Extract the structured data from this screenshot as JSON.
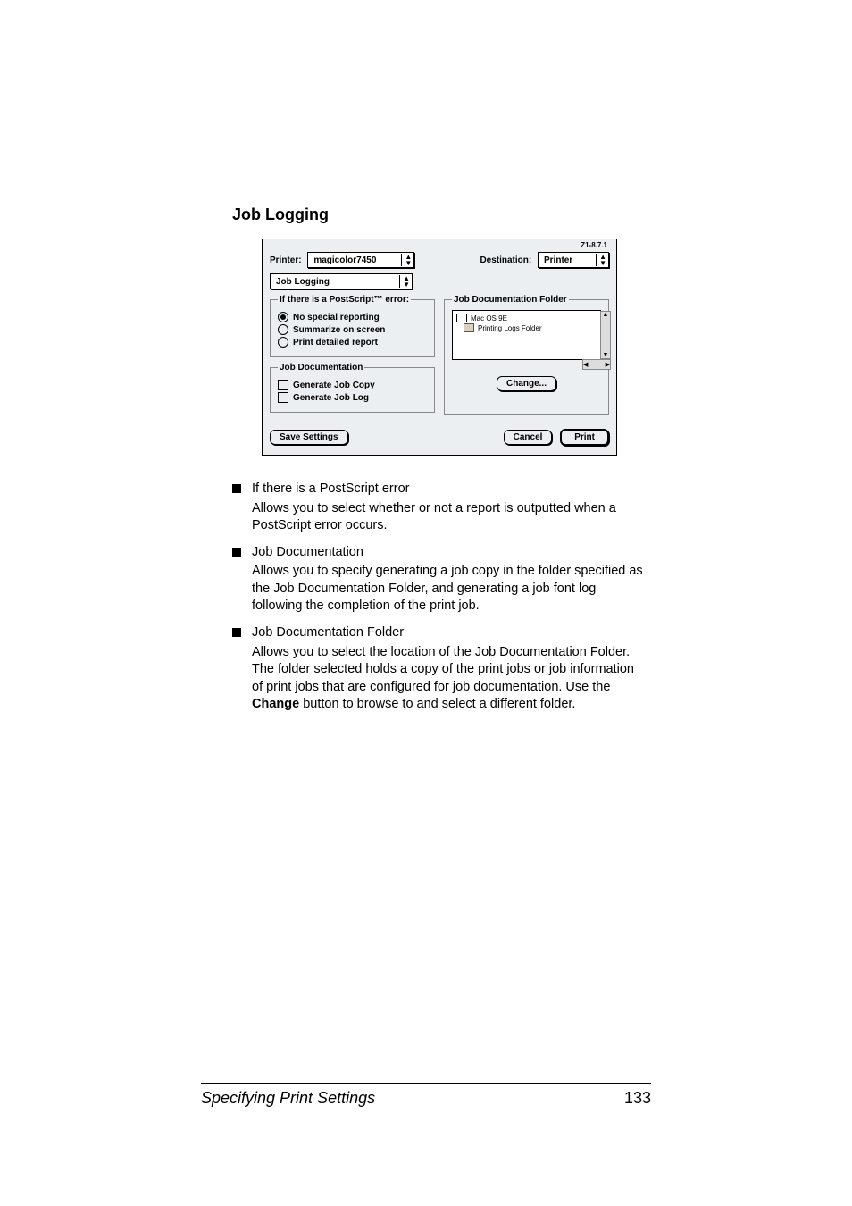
{
  "heading": "Job Logging",
  "dialog": {
    "version": "Z1-8.7.1",
    "printer_label": "Printer:",
    "printer_value": "magicolor7450",
    "destination_label": "Destination:",
    "destination_value": "Printer",
    "section_popup": "Job Logging",
    "ps_error": {
      "legend": "If there is a PostScript™ error:",
      "opt1": "No special reporting",
      "opt2": "Summarize on screen",
      "opt3": "Print detailed report"
    },
    "jobdoc": {
      "legend": "Job Documentation",
      "chk1": "Generate Job Copy",
      "chk2": "Generate Job Log"
    },
    "jobdoc_folder": {
      "legend": "Job Documentation Folder",
      "entry1": "Mac OS 9E",
      "entry2": "Printing Logs Folder",
      "change": "Change..."
    },
    "save_settings": "Save Settings",
    "cancel": "Cancel",
    "print": "Print"
  },
  "bullets": [
    {
      "title": "If there is a PostScript error",
      "body": "Allows you to select whether or not a report is outputted when a PostScript error occurs."
    },
    {
      "title": "Job Documentation",
      "body": "Allows you to specify generating a job copy in the folder specified as the Job Documentation Folder, and generating a job font log following the completion of the print job."
    },
    {
      "title": "Job Documentation Folder",
      "body_pre": "Allows you to select the location of the Job Documentation Folder. The folder selected holds a copy of the print jobs or job information of print jobs that are configured for job documentation. Use the ",
      "body_bold": "Change",
      "body_post": " button to browse to and select a different folder."
    }
  ],
  "footer": {
    "left": "Specifying Print Settings",
    "right": "133"
  }
}
